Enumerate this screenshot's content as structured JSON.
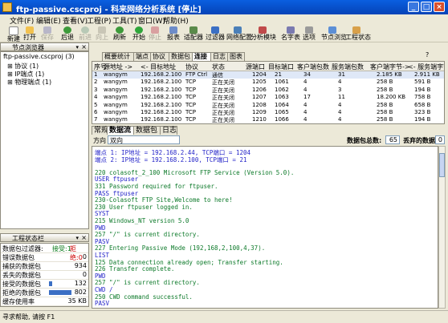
{
  "window": {
    "title": "ftp-passive.cscproj - 科来网络分析系统 [停止]"
  },
  "menu": [
    "文件(F)",
    "编辑(E)",
    "查看(V)",
    "工程(P)",
    "工具(T)",
    "窗口(W)",
    "帮助(H)"
  ],
  "toolbar": [
    {
      "label": "新建",
      "icon": "new-icon",
      "disabled": false
    },
    {
      "label": "打开",
      "icon": "open-icon",
      "disabled": false
    },
    {
      "label": "保存",
      "icon": "save-icon",
      "disabled": true
    },
    {
      "label": "后退",
      "icon": "back-icon",
      "disabled": false
    },
    {
      "label": "前进",
      "icon": "forward-icon",
      "disabled": true
    },
    {
      "label": "向上",
      "icon": "up-icon",
      "disabled": true
    },
    {
      "label": "刷新",
      "icon": "refresh-icon",
      "disabled": false
    },
    {
      "label": "开始",
      "icon": "start-icon",
      "disabled": false
    },
    {
      "label": "停止",
      "icon": "stop-icon",
      "disabled": true
    },
    {
      "label": "报表",
      "icon": "report-icon",
      "disabled": false
    },
    {
      "label": "适配器",
      "icon": "adapter-icon",
      "disabled": false
    },
    {
      "label": "过滤器",
      "icon": "filter-icon",
      "disabled": false
    },
    {
      "label": "网络配置",
      "icon": "network-config-icon",
      "disabled": false
    },
    {
      "label": "分析模块",
      "icon": "analysis-module-icon",
      "disabled": false
    },
    {
      "label": "名字表",
      "icon": "name-table-icon",
      "disabled": false
    },
    {
      "label": "选项",
      "icon": "options-icon",
      "disabled": false
    },
    {
      "label": "节点浏览",
      "icon": "node-browse-icon",
      "disabled": false
    },
    {
      "label": "工程状态",
      "icon": "project-status-icon",
      "disabled": false
    }
  ],
  "node_browser": {
    "title": "节点浏览器",
    "root": "ftp-passive.cscproj (3)",
    "children": [
      "协议 (1)",
      "IP端点 (1)",
      "物理端点 (1)"
    ]
  },
  "project_stats": {
    "title": "工程状态栏",
    "filter_label": "数据包过滤器:",
    "accept": "接受:1",
    "reject": "拒绝:0",
    "rows": [
      {
        "label": "错误数据包",
        "value": "0",
        "fill": 0
      },
      {
        "label": "捕获的数据包",
        "value": "934",
        "fill": 0
      },
      {
        "label": "丢失的数据包",
        "value": "0",
        "fill": 0
      },
      {
        "label": "接受的数据包",
        "value": "132",
        "fill": 0.14
      },
      {
        "label": "拒绝的数据包",
        "value": "802",
        "fill": 0.86
      },
      {
        "label": "缓存使用率",
        "value": "35 KB",
        "fill": 0
      }
    ]
  },
  "top_tabs": [
    "概要统计",
    "端点",
    "协议",
    "数据包",
    "连接",
    "日志",
    "图表"
  ],
  "top_tabs_active": 4,
  "conn_table": {
    "headers": [
      "序号",
      "源地址 ->",
      "<- 目标地址",
      "协议",
      "状态",
      "源端口",
      "目标端口",
      "客户端包数",
      "服务端包数",
      "客户端字节->",
      "<- 服务端字节"
    ],
    "rows": [
      [
        "1",
        "wangym",
        "192.168.2.100",
        "FTP Ctrl",
        "通信",
        "1204",
        "21",
        "34",
        "31",
        "2.185 KB",
        "2.911 KB"
      ],
      [
        "2",
        "wangym",
        "192.168.2.100",
        "TCP",
        "正在关闭",
        "1205",
        "1061",
        "4",
        "4",
        "258 B",
        "591 B"
      ],
      [
        "3",
        "wangym",
        "192.168.2.100",
        "TCP",
        "正在关闭",
        "1206",
        "1062",
        "4",
        "3",
        "258 B",
        "194 B"
      ],
      [
        "4",
        "wangym",
        "192.168.2.100",
        "TCP",
        "正在关闭",
        "1207",
        "1063",
        "17",
        "11",
        "18.200 KB",
        "758 B"
      ],
      [
        "5",
        "wangym",
        "192.168.2.100",
        "TCP",
        "正在关闭",
        "1208",
        "1064",
        "4",
        "4",
        "258 B",
        "658 B"
      ],
      [
        "6",
        "wangym",
        "192.168.2.100",
        "TCP",
        "正在关闭",
        "1209",
        "1065",
        "4",
        "4",
        "258 B",
        "323 B"
      ],
      [
        "7",
        "wangym",
        "192.168.2.100",
        "TCP",
        "正在关闭",
        "1210",
        "1066",
        "4",
        "4",
        "258 B",
        "194 B"
      ]
    ]
  },
  "sub_tabs": [
    "常规",
    "数据流",
    "数据包",
    "日志"
  ],
  "sub_tabs_active": 1,
  "filter_bar": {
    "direction_label": "方向",
    "direction_value": "双向",
    "pkt_total_label": "数据包总数:",
    "pkt_total": "65",
    "lost_label": "丢弃的数据包:",
    "lost": "0"
  },
  "log": [
    {
      "t": "端点 1: IP地址 = 192.168.2.44, TCP端口 = 1204",
      "c": "blue"
    },
    {
      "t": "端点 2: IP地址 = 192.168.2.100, TCP端口 = 21",
      "c": "blue"
    },
    {
      "t": "",
      "c": "green"
    },
    {
      "t": "220 colasoft_2_100 Microsoft FTP Service (Version 5.0).",
      "c": "green"
    },
    {
      "t": "USER ftpuser",
      "c": "blue"
    },
    {
      "t": "331 Password required for ftpuser.",
      "c": "green"
    },
    {
      "t": "PASS ftpuser",
      "c": "blue"
    },
    {
      "t": "230-Colasoft  FTP Site,Welcome to here!",
      "c": "green"
    },
    {
      "t": "230 User ftpuser logged in.",
      "c": "green"
    },
    {
      "t": "SYST",
      "c": "blue"
    },
    {
      "t": "215 Windows_NT version 5.0",
      "c": "green"
    },
    {
      "t": "PWD",
      "c": "blue"
    },
    {
      "t": "257 \"/\" is current directory.",
      "c": "green"
    },
    {
      "t": "PASV",
      "c": "blue"
    },
    {
      "t": "227 Entering Passive Mode (192,168,2,100,4,37).",
      "c": "green"
    },
    {
      "t": "LIST",
      "c": "blue"
    },
    {
      "t": "125 Data connection already open; Transfer starting.",
      "c": "green"
    },
    {
      "t": "226 Transfer complete.",
      "c": "green"
    },
    {
      "t": "PWD",
      "c": "blue"
    },
    {
      "t": "257 \"/\" is current directory.",
      "c": "green"
    },
    {
      "t": "CWD /",
      "c": "blue"
    },
    {
      "t": "250 CWD command successful.",
      "c": "green"
    },
    {
      "t": "PASV",
      "c": "blue"
    }
  ],
  "statusbar": {
    "text": "寻求帮助, 请按 F1"
  },
  "colors": {
    "title_bg": "#0A5FE0",
    "log_blue": "#2323c8",
    "log_green": "#0d7a2a",
    "accent": "#3b6fc4"
  }
}
